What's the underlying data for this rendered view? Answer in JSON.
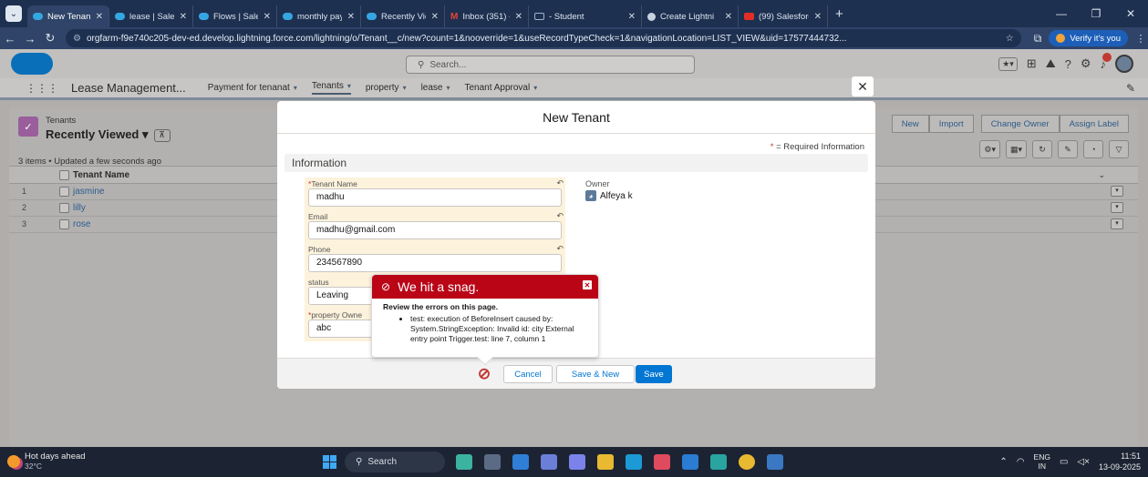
{
  "browser": {
    "tabs": [
      {
        "title": "New Tenant | S",
        "active": true,
        "favicon": "salesforce"
      },
      {
        "title": "lease | Salesfo",
        "favicon": "salesforce"
      },
      {
        "title": "Flows | Salesfo",
        "favicon": "salesforce"
      },
      {
        "title": "monthly paym",
        "favicon": "salesforce"
      },
      {
        "title": "Recently View",
        "favicon": "salesforce"
      },
      {
        "title": "Inbox (351) -",
        "favicon": "gmail"
      },
      {
        "title": "- Student",
        "favicon": "student"
      },
      {
        "title": "Create Lightni",
        "favicon": "chrome"
      },
      {
        "title": "(99) Salesforce",
        "favicon": "youtube"
      }
    ],
    "url": "orgfarm-f9e740c205-dev-ed.develop.lightning.force.com/lightning/o/Tenant__c/new?count=1&nooverride=1&useRecordTypeCheck=1&navigationLocation=LIST_VIEW&uid=17577444732...",
    "verify_label": "Verify it's you"
  },
  "sf": {
    "search_placeholder": "Search...",
    "app_name": "Lease Management...",
    "nav": [
      {
        "label": "Payment for tenanat"
      },
      {
        "label": "Tenants",
        "active": true
      },
      {
        "label": "property"
      },
      {
        "label": "lease"
      },
      {
        "label": "Tenant Approval"
      }
    ],
    "list": {
      "object_label": "Tenants",
      "view_name": "Recently Viewed",
      "meta": "3 items • Updated a few seconds ago",
      "column": "Tenant Name",
      "buttons": [
        "New",
        "Import",
        "Change Owner",
        "Assign Label"
      ],
      "rows": [
        {
          "num": "1",
          "name": "jasmine"
        },
        {
          "num": "2",
          "name": "lilly"
        },
        {
          "num": "3",
          "name": "rose"
        }
      ]
    }
  },
  "modal": {
    "title": "New Tenant",
    "required_note": "= Required Information",
    "section": "Information",
    "fields": [
      {
        "label": "Tenant Name",
        "required": true,
        "value": "madhu"
      },
      {
        "label": "Email",
        "required": false,
        "value": "madhu@gmail.com"
      },
      {
        "label": "Phone",
        "required": false,
        "value": "234567890"
      },
      {
        "label": "status",
        "required": false,
        "value": "Leaving"
      },
      {
        "label": "property Owne",
        "required": true,
        "value": "abc"
      }
    ],
    "owner_label": "Owner",
    "owner_value": "Alfeya k",
    "buttons": {
      "cancel": "Cancel",
      "save_new": "Save & New",
      "save": "Save"
    }
  },
  "error": {
    "title": "We hit a snag.",
    "heading": "Review the errors on this page.",
    "message": "test: execution of BeforeInsert caused by: System.StringException: Invalid id: city External entry point Trigger.test: line 7, column 1"
  },
  "taskbar": {
    "weather_title": "Hot days ahead",
    "weather_temp": "32°C",
    "search": "Search",
    "lang_top": "ENG",
    "lang_bottom": "IN",
    "time": "11:51",
    "date": "13-09-2025"
  },
  "colors": {
    "error_red": "#ba0517",
    "brand_blue": "#0176d3",
    "field_highlight": "#fdf2dc"
  }
}
